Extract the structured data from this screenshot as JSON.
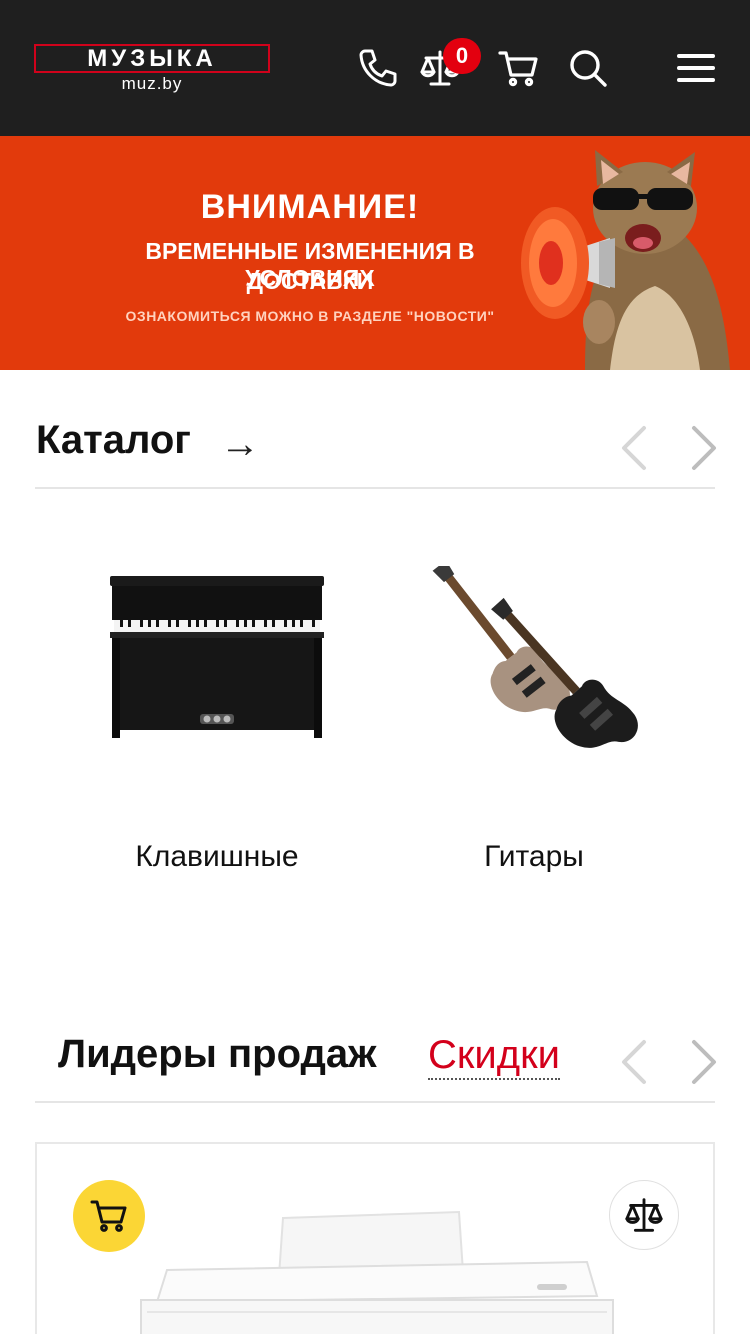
{
  "header": {
    "logo_word": "МУЗЫКА",
    "logo_domain": "muz.by",
    "compare_count": "0",
    "icons": [
      "phone-icon",
      "scales-icon",
      "cart-icon",
      "search-icon",
      "menu-icon"
    ]
  },
  "banner": {
    "title": "ВНИМАНИЕ!",
    "line1": "ВРЕМЕННЫЕ ИЗМЕНЕНИЯ В УСЛОВИЯХ",
    "line2": "ДОСТАВКИ",
    "note": "ОЗНАКОМИТЬСЯ МОЖНО В РАЗДЕЛЕ \"НОВОСТИ\""
  },
  "catalog": {
    "title": "Каталог",
    "arrow": "→",
    "items": [
      {
        "label": "Клавишные",
        "image": "digital-piano-image"
      },
      {
        "label": "Гитары",
        "image": "electric-guitars-image"
      }
    ]
  },
  "leaders": {
    "title": "Лидеры продаж",
    "tab_sale": "Скидки"
  },
  "colors": {
    "header_bg": "#1f1f1f",
    "banner_bg": "#e23a0c",
    "accent_red": "#d3001b",
    "cart_button": "#fbd635"
  }
}
